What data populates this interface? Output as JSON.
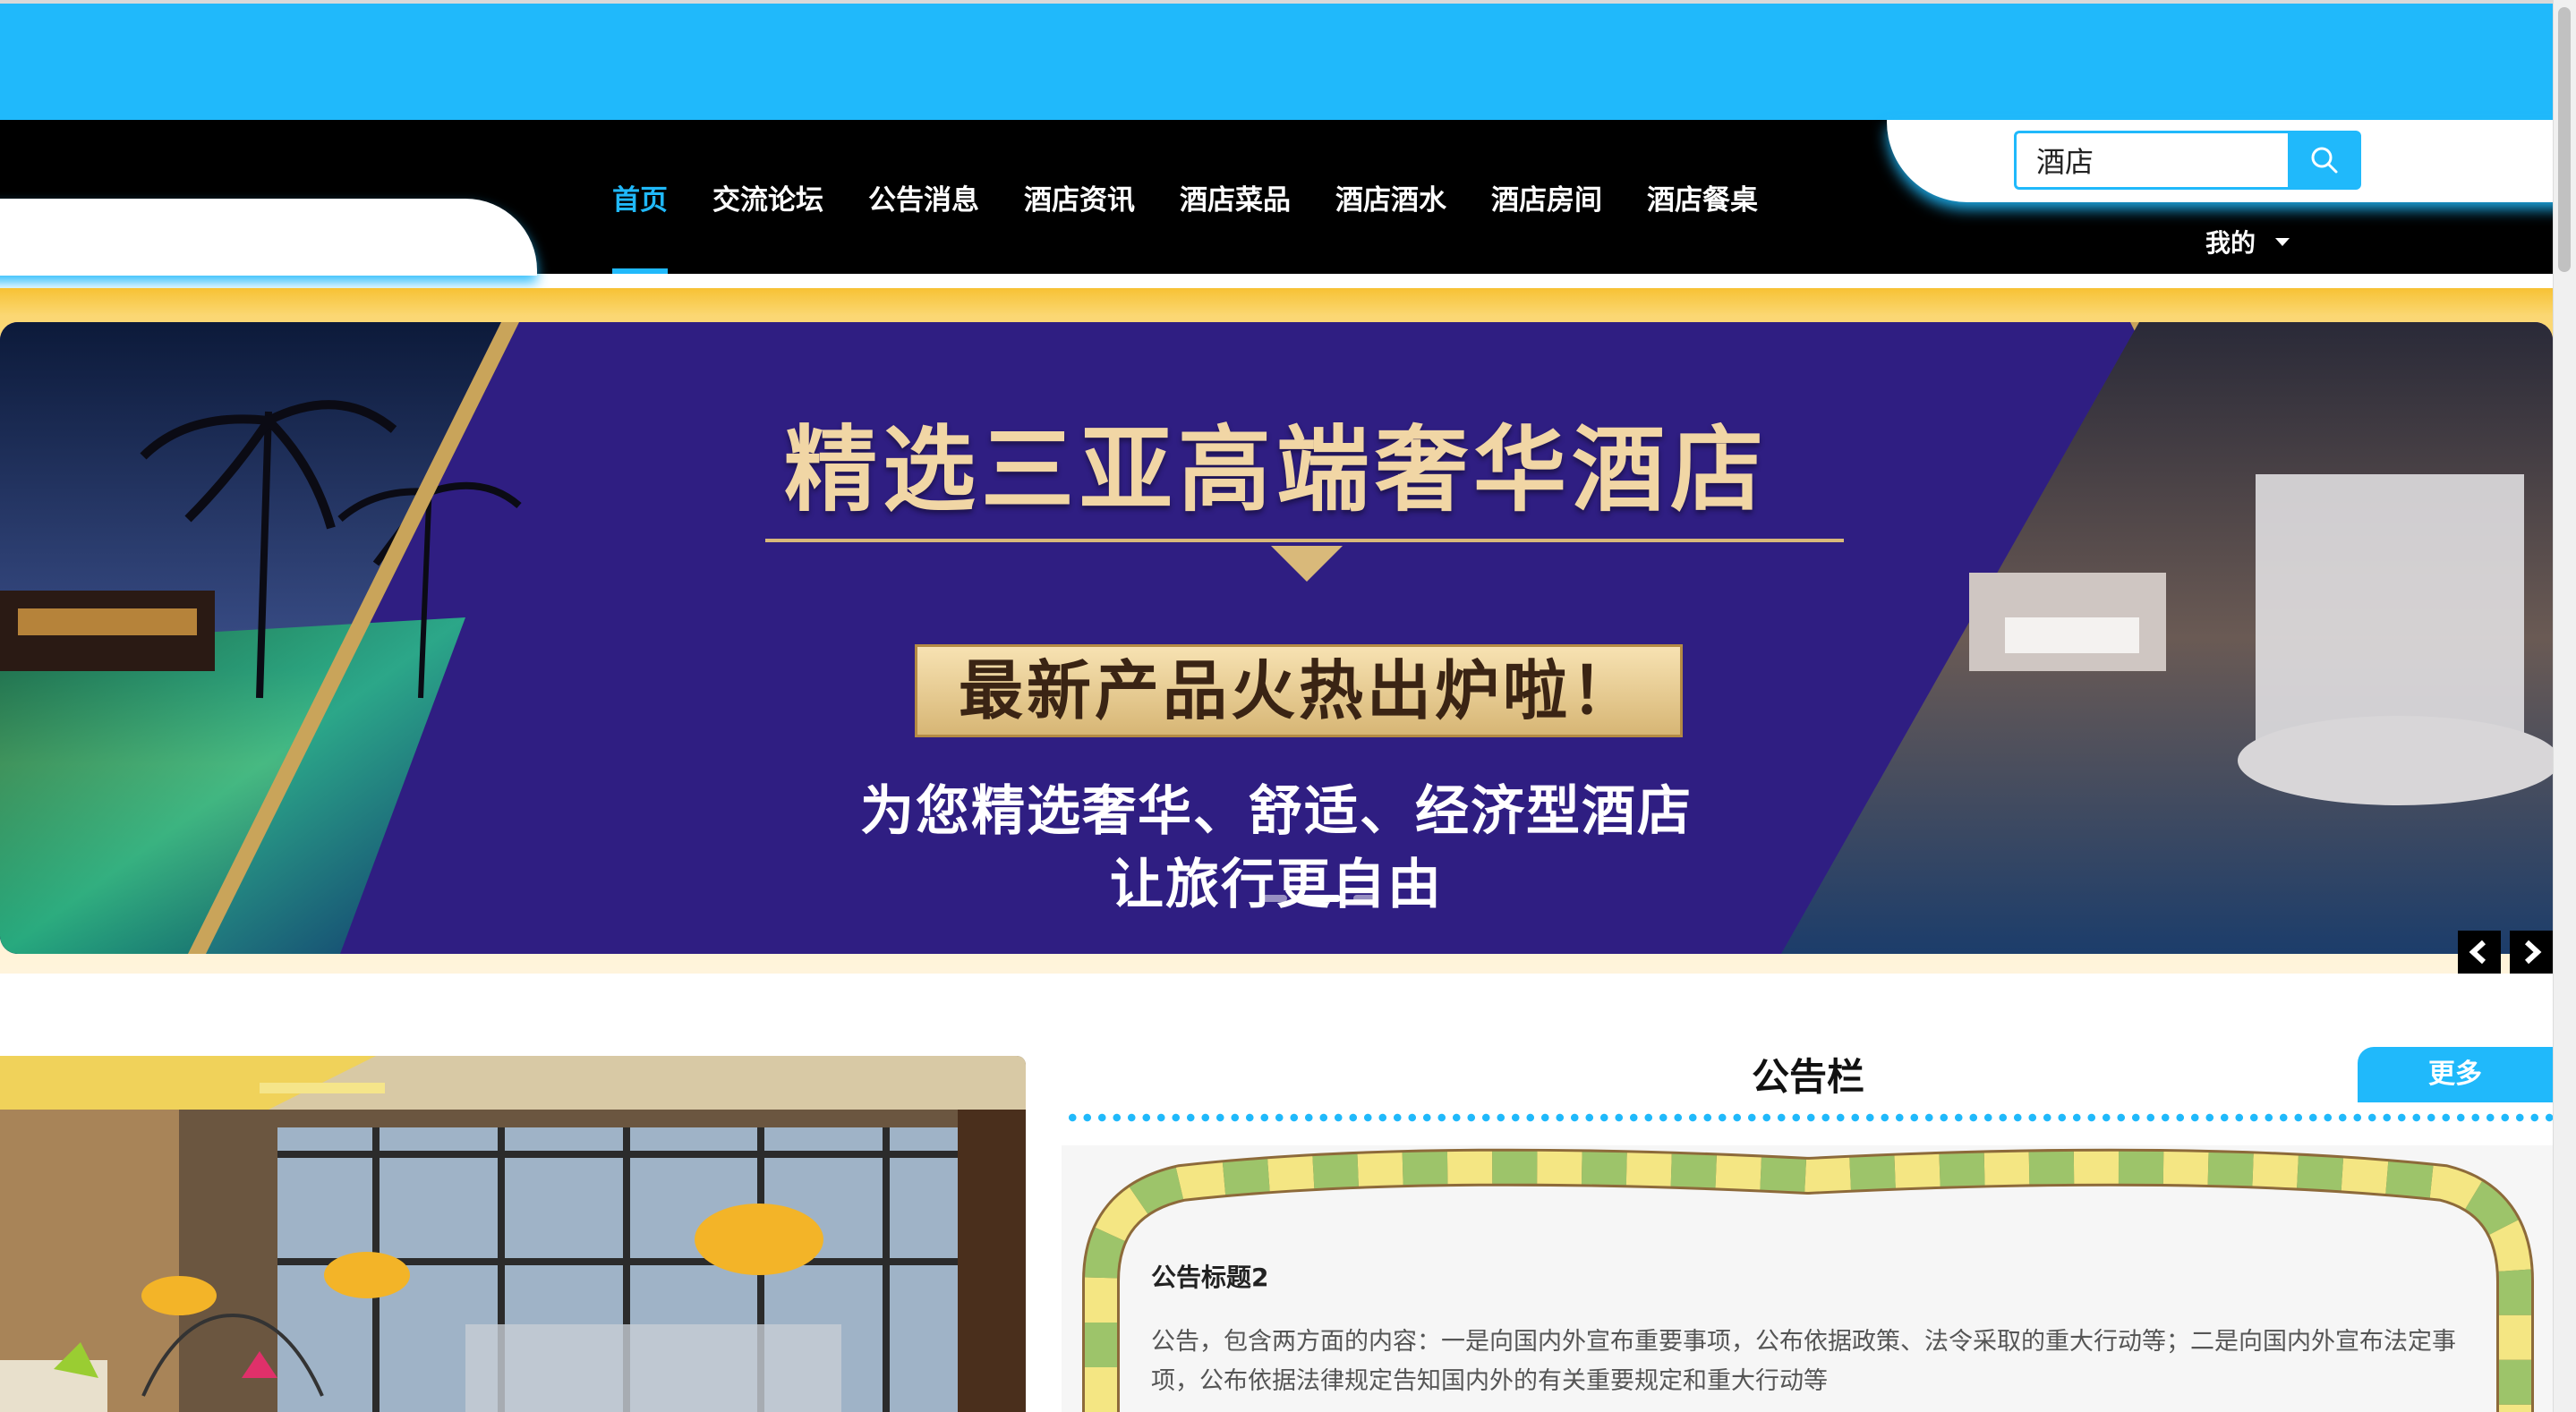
{
  "nav": {
    "items": [
      {
        "label": "首页",
        "active": true
      },
      {
        "label": "交流论坛"
      },
      {
        "label": "公告消息"
      },
      {
        "label": "酒店资讯"
      },
      {
        "label": "酒店菜品"
      },
      {
        "label": "酒店酒水"
      },
      {
        "label": "酒店房间"
      },
      {
        "label": "酒店餐桌"
      }
    ],
    "search": {
      "value": "酒店",
      "icon": "search-icon"
    },
    "user_menu": {
      "label": "我的",
      "icon": "caret-down-icon"
    }
  },
  "banner": {
    "title": "精选三亚高端奢华酒店",
    "subtitle": "最新产品火热出炉啦！",
    "line1": "为您精选奢华、舒适、经济型酒店",
    "line2": "让旅行更自由",
    "slides": 3,
    "active_slide": 1,
    "prev_icon": "chevron-left-icon",
    "next_icon": "chevron-right-icon"
  },
  "notice": {
    "heading": "公告栏",
    "more_label": "更多",
    "items": [
      {
        "title": "公告标题2",
        "body": "公告，包含两方面的内容：一是向国内外宣布重要事项，公布依据政策、法令采取的重大行动等；二是向国内外宣布法定事项，公布依据法律规定告知国内外的有关重要规定和重大行动等"
      }
    ]
  },
  "colors": {
    "accent": "#20b9fb",
    "nav_bg": "#000000",
    "banner_bg": "#2f1e82",
    "banner_gold": "#f1d6a5"
  }
}
